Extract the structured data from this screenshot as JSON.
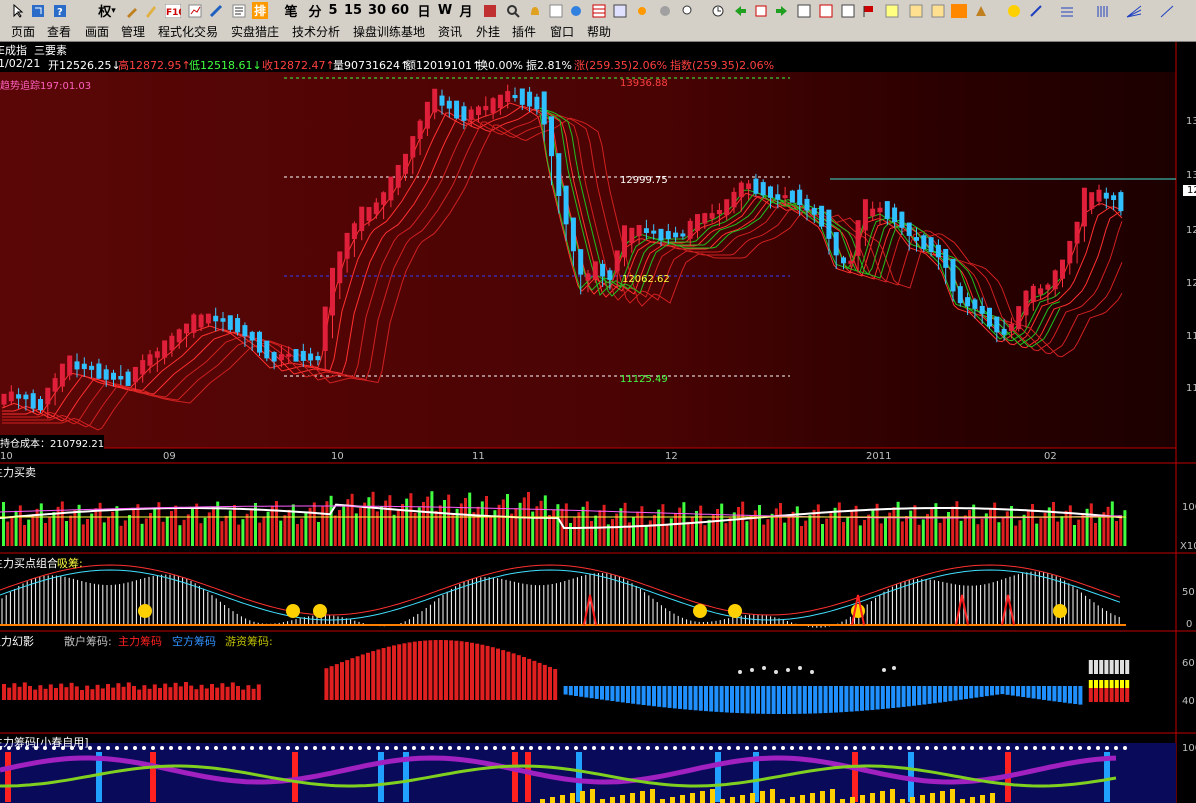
{
  "toolbar": {
    "buttons": [
      {
        "icon": "pointer-icon"
      },
      {
        "icon": "zoom-icon"
      },
      {
        "icon": "help-icon"
      },
      {
        "icon": "right-label",
        "label": "权"
      },
      {
        "icon": "tools-icon"
      },
      {
        "icon": "pen-icon"
      },
      {
        "icon": "f10-icon",
        "label": "F10"
      },
      {
        "icon": "chart-icon"
      },
      {
        "icon": "draw-icon"
      },
      {
        "icon": "news-icon"
      },
      {
        "icon": "list-icon"
      },
      {
        "icon": "pie-icon"
      },
      {
        "icon": "grid-icon"
      }
    ],
    "period_buttons": [
      "排",
      "笔",
      "分",
      "5",
      "15",
      "30",
      "60",
      "日",
      "W",
      "月"
    ],
    "colors": {
      "bg": "#d4d0c8",
      "accent": "#ff9900"
    }
  },
  "menubar": {
    "items": [
      "页面",
      "查看",
      "画面",
      "管理",
      "程式化交易",
      "实盘猎庄",
      "技术分析",
      "操盘训练基地",
      "资讯",
      "外挂",
      "插件",
      "窗口",
      "帮助"
    ]
  },
  "title": {
    "index_name": "E成指",
    "tool_name": "三要素"
  },
  "infobar": {
    "date": "1/02/21",
    "open": "开12526.25↓",
    "high": "高12872.95↑",
    "low": "低12518.61↓",
    "close": "收12872.47↑",
    "volume": "量90731624↑",
    "amount": "额12019101↑",
    "turnover": "换0.00%",
    "amplitude": "振2.81%",
    "change": "涨(259.35)2.06%",
    "index": "指数(259.35)2.06%",
    "colors": {
      "up": "#ff4040",
      "down": "#40ff40",
      "normal": "#ffffff"
    }
  },
  "main_chart": {
    "overlay_label": "趋势追踪197:01.03",
    "cost_label": "持仓成本：210792.21",
    "levels": [
      {
        "value": "13936.88",
        "color": "#ff4040"
      },
      {
        "value": "12999.75",
        "color": "#ffffff"
      },
      {
        "value": "12062.62",
        "color": "#ffff40"
      },
      {
        "value": "11125.49",
        "color": "#40ff40"
      }
    ],
    "price_ticks": [
      "13",
      "13",
      "12",
      "12",
      "11",
      "11"
    ],
    "current_price_label": "12"
  },
  "time_axis": {
    "labels": [
      "10",
      "09",
      "10",
      "11",
      "12",
      "2011",
      "02"
    ]
  },
  "panel1": {
    "title": "主力买卖",
    "ticks": [
      "100",
      "X10"
    ]
  },
  "panel2": {
    "title": "主力买点组合",
    "subtitle": "吸筹:",
    "ticks": [
      "50",
      "0"
    ]
  },
  "panel3": {
    "title": "主力幻影",
    "legend": [
      {
        "label": "散户筹码:",
        "color": "#c0c0c0"
      },
      {
        "label": "主力筹码",
        "color": "#ff2020"
      },
      {
        "label": "空方筹码",
        "color": "#3090ff"
      },
      {
        "label": "游资筹码:",
        "color": "#c0c000"
      }
    ],
    "ticks": [
      "60",
      "40"
    ]
  },
  "panel4": {
    "title": "主力筹码[小春自用]",
    "ticks": [
      "100"
    ]
  }
}
